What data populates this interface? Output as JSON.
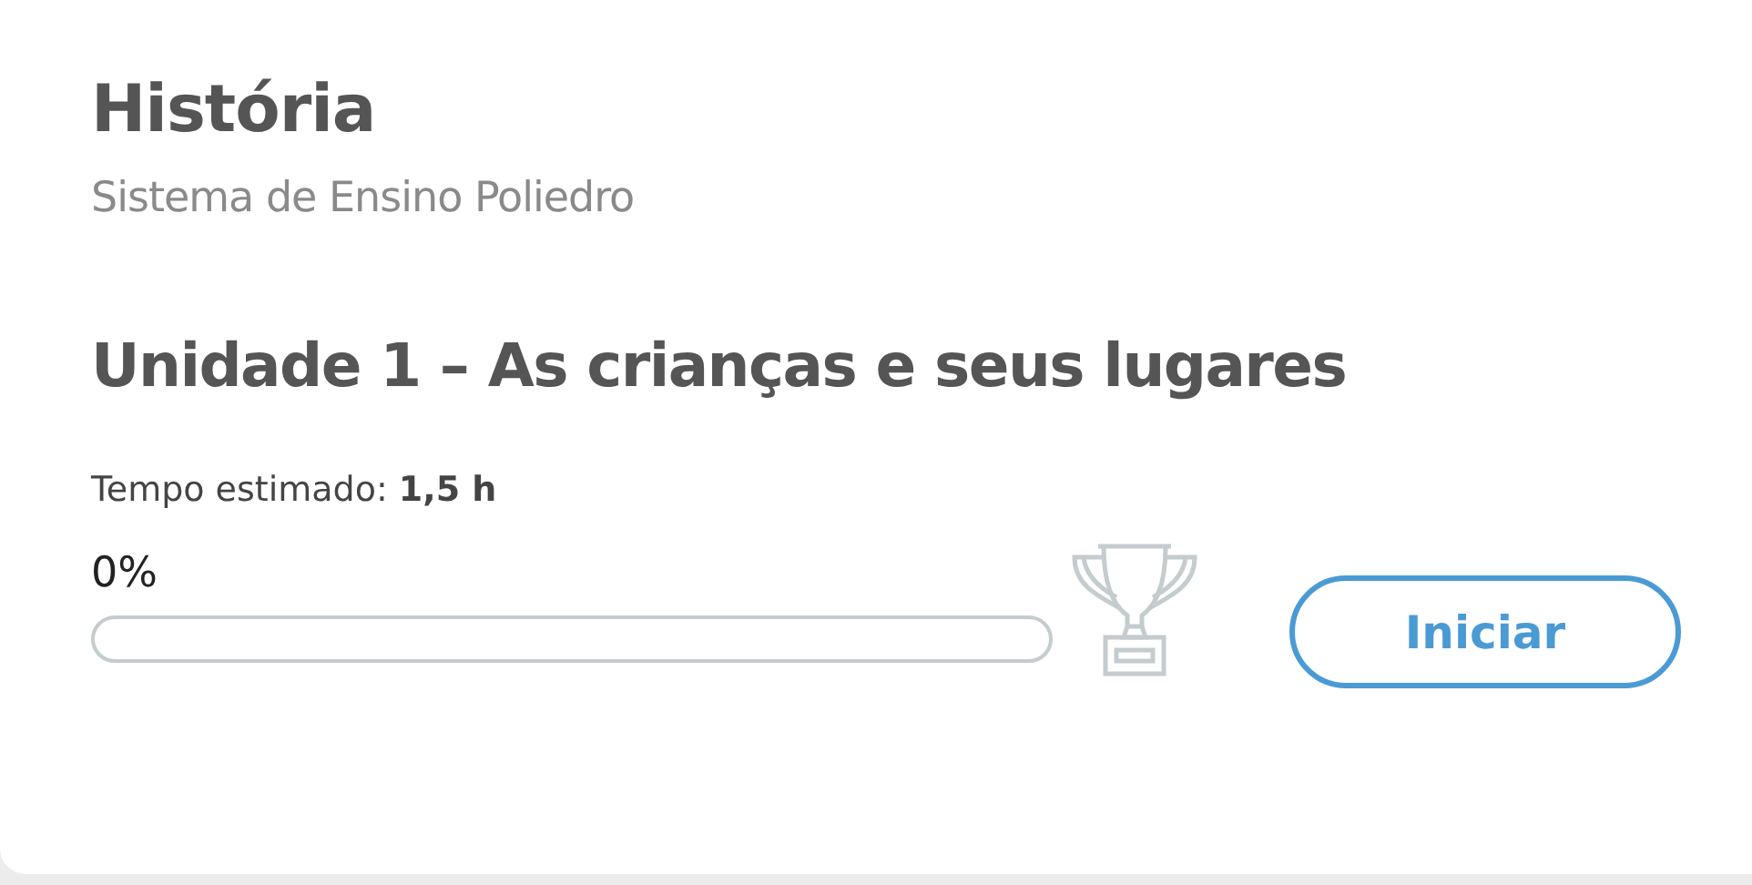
{
  "course": {
    "title": "História",
    "subtitle": "Sistema de Ensino Poliedro"
  },
  "unit": {
    "title": "Unidade 1 – As crianças e seus lugares",
    "estimate": "Tempo estimado: **1,5 h**",
    "progress_label": "0%",
    "level": 0
  },
  "buttons": [
    {
      "label": "Iniciar"
    }
  ]
}
